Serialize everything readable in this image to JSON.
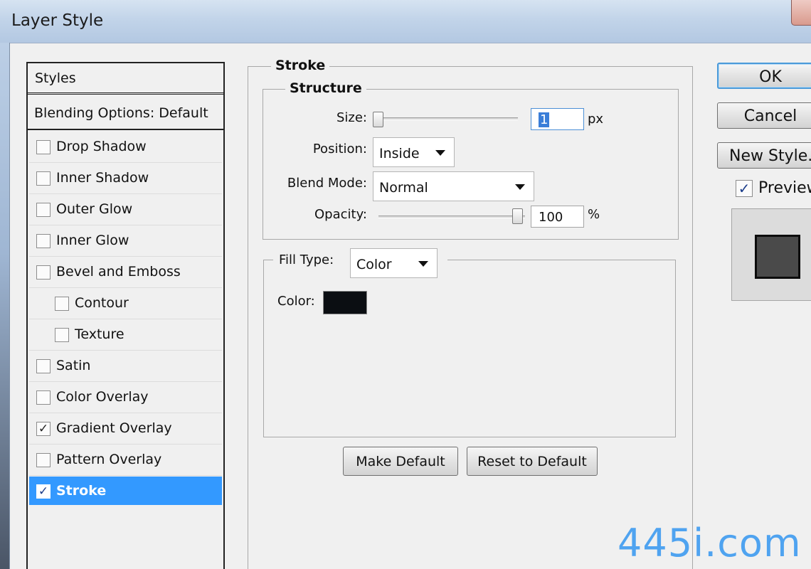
{
  "window": {
    "title": "Layer Style"
  },
  "styles_panel": {
    "header": "Styles",
    "blending_options": "Blending Options: Default",
    "items": [
      {
        "label": "Drop Shadow",
        "checked": false,
        "indent": false
      },
      {
        "label": "Inner Shadow",
        "checked": false,
        "indent": false
      },
      {
        "label": "Outer Glow",
        "checked": false,
        "indent": false
      },
      {
        "label": "Inner Glow",
        "checked": false,
        "indent": false
      },
      {
        "label": "Bevel and Emboss",
        "checked": false,
        "indent": false
      },
      {
        "label": "Contour",
        "checked": false,
        "indent": true
      },
      {
        "label": "Texture",
        "checked": false,
        "indent": true
      },
      {
        "label": "Satin",
        "checked": false,
        "indent": false
      },
      {
        "label": "Color Overlay",
        "checked": false,
        "indent": false
      },
      {
        "label": "Gradient Overlay",
        "checked": true,
        "indent": false
      },
      {
        "label": "Pattern Overlay",
        "checked": false,
        "indent": false
      },
      {
        "label": "Stroke",
        "checked": true,
        "indent": false,
        "selected": true
      }
    ],
    "check_glyph": "✓"
  },
  "stroke": {
    "group_title": "Stroke",
    "structure_title": "Structure",
    "size": {
      "label": "Size:",
      "value": "1",
      "unit": "px",
      "slider_fraction": 0.0
    },
    "position": {
      "label": "Position:",
      "value": "Inside"
    },
    "blend_mode": {
      "label": "Blend Mode:",
      "value": "Normal"
    },
    "opacity": {
      "label": "Opacity:",
      "value": "100",
      "unit": "%",
      "slider_fraction": 1.0
    },
    "fill_type": {
      "label": "Fill Type:",
      "value": "Color"
    },
    "color": {
      "label": "Color:",
      "swatch": "#0b0e12"
    },
    "make_default_label": "Make Default",
    "reset_default_label": "Reset to Default"
  },
  "actions": {
    "ok_label": "OK",
    "cancel_label": "Cancel",
    "new_style_label": "New Style...",
    "preview_label": "Preview",
    "preview_checked": true
  },
  "colors": {
    "selection": "#3399ff",
    "accent_focus": "#4b9ad9"
  },
  "watermark": "445i.com"
}
